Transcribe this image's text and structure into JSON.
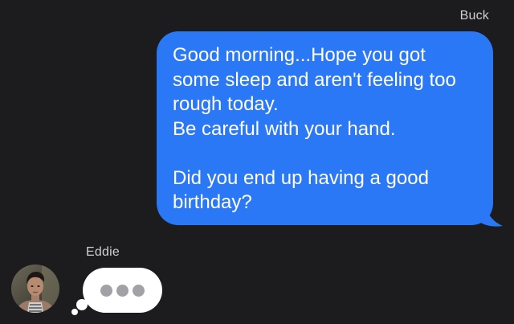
{
  "conversation": {
    "outgoing": {
      "sender": "Buck",
      "text": "Good morning...Hope you got\nsome sleep and aren't feeling too\nrough today.\nBe careful with your hand.\n\nDid you end up having a good\nbirthday?",
      "bubble_color": "#2b78f6"
    },
    "incoming": {
      "sender": "Eddie",
      "avatar_icon": "contact-photo",
      "status_icon": "typing-indicator-icon"
    }
  },
  "colors": {
    "background": "#1c1c1e",
    "outgoing_bubble": "#2b78f6",
    "typing_bubble": "#ffffff",
    "typing_dots": "#a1a1a6"
  }
}
